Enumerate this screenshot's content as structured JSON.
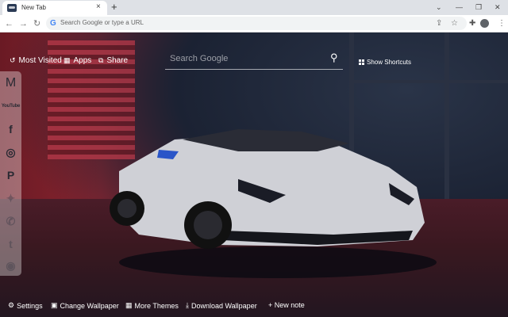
{
  "browser": {
    "tab_title": "New Tab",
    "tab_close": "×",
    "new_tab": "+",
    "omnibox_placeholder": "Search Google or type a URL",
    "google_glyph": "G",
    "icons": [
      "back-icon",
      "forward-icon",
      "reload-icon",
      "share-icon",
      "star-icon",
      "extensions-icon",
      "profile-icon",
      "menu-icon"
    ]
  },
  "topnav": {
    "most_visited": "Most Visited",
    "apps": "Apps",
    "share": "Share"
  },
  "search": {
    "placeholder": "Search Google"
  },
  "shortcuts": {
    "label": "Show Shortcuts"
  },
  "sidebar": {
    "items": [
      {
        "name": "gmail",
        "glyph": "M"
      },
      {
        "name": "youtube",
        "glyph": "YouTube"
      },
      {
        "name": "facebook",
        "glyph": "f"
      },
      {
        "name": "instagram",
        "glyph": "◎"
      },
      {
        "name": "pinterest",
        "glyph": "P"
      },
      {
        "name": "twitter",
        "glyph": "✦"
      },
      {
        "name": "whatsapp",
        "glyph": "✆"
      },
      {
        "name": "tumblr",
        "glyph": "t"
      },
      {
        "name": "reddit",
        "glyph": "◉"
      }
    ]
  },
  "bottombar": {
    "settings": "Settings",
    "change_wallpaper": "Change Wallpaper",
    "more_themes": "More Themes",
    "download_wallpaper": "Download Wallpaper",
    "new_note": "+ New note"
  },
  "colors": {
    "tabbar_bg": "#dee1e6",
    "wall_red": "#8a2530",
    "wall_blue": "#1c2030",
    "car_body": "#d8d8de"
  }
}
